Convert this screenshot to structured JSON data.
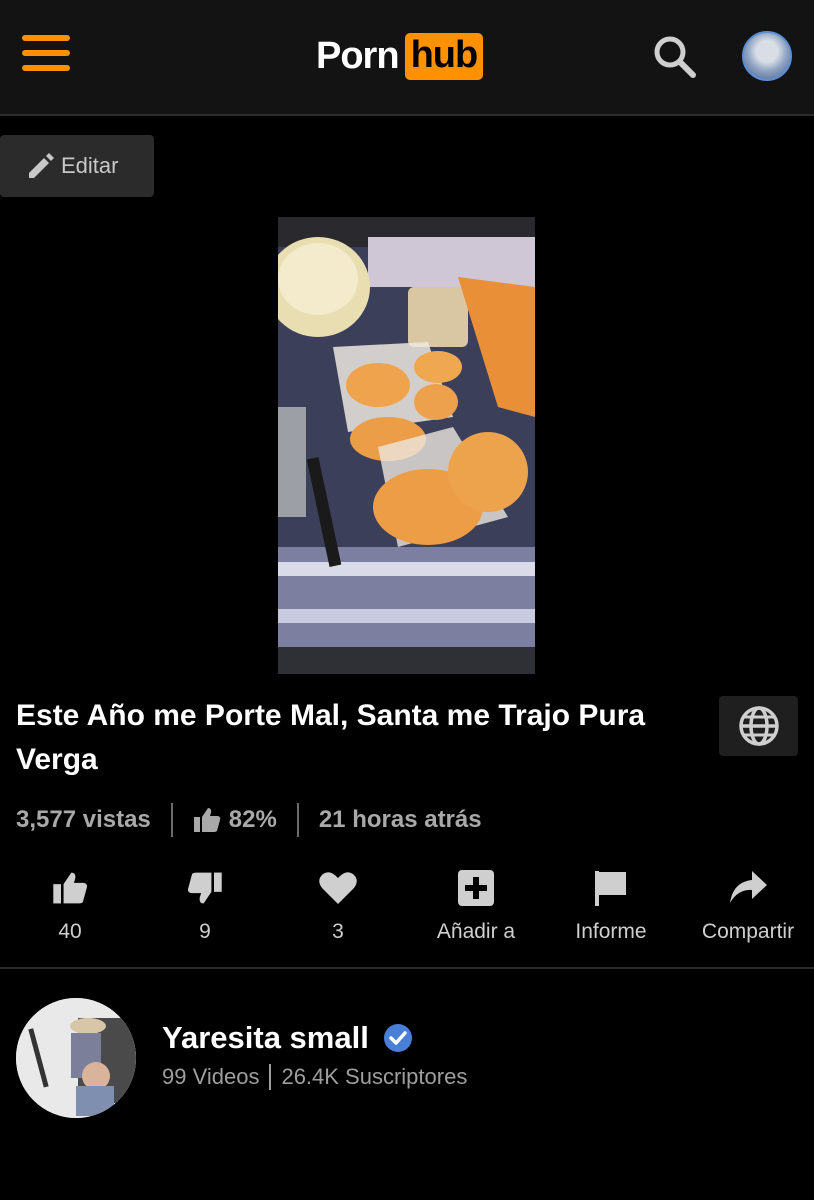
{
  "header": {
    "logo_porn": "Porn",
    "logo_hub": "hub",
    "menu_icon": "hamburger-menu-icon",
    "search_icon": "search-icon",
    "accent_color": "#ff9000"
  },
  "edit_button": {
    "label": "Editar",
    "icon": "pencil-icon"
  },
  "video": {
    "title": "Este Año me Porte Mal, Santa me Trajo Pura Verga",
    "views": "3,577 vistas",
    "rating": "82%",
    "time_ago": "21 horas atrás"
  },
  "actions": [
    {
      "icon": "thumbs-up-icon",
      "label": "40"
    },
    {
      "icon": "thumbs-down-icon",
      "label": "9"
    },
    {
      "icon": "heart-icon",
      "label": "3"
    },
    {
      "icon": "add-square-icon",
      "label": "Añadir a"
    },
    {
      "icon": "flag-icon",
      "label": "Informe"
    },
    {
      "icon": "share-arrow-icon",
      "label": "Compartir"
    }
  ],
  "channel": {
    "name": "Yaresita small",
    "videos": "99 Videos",
    "subscribers": "26.4K Suscriptores",
    "verified_color": "#4a7fd8"
  }
}
